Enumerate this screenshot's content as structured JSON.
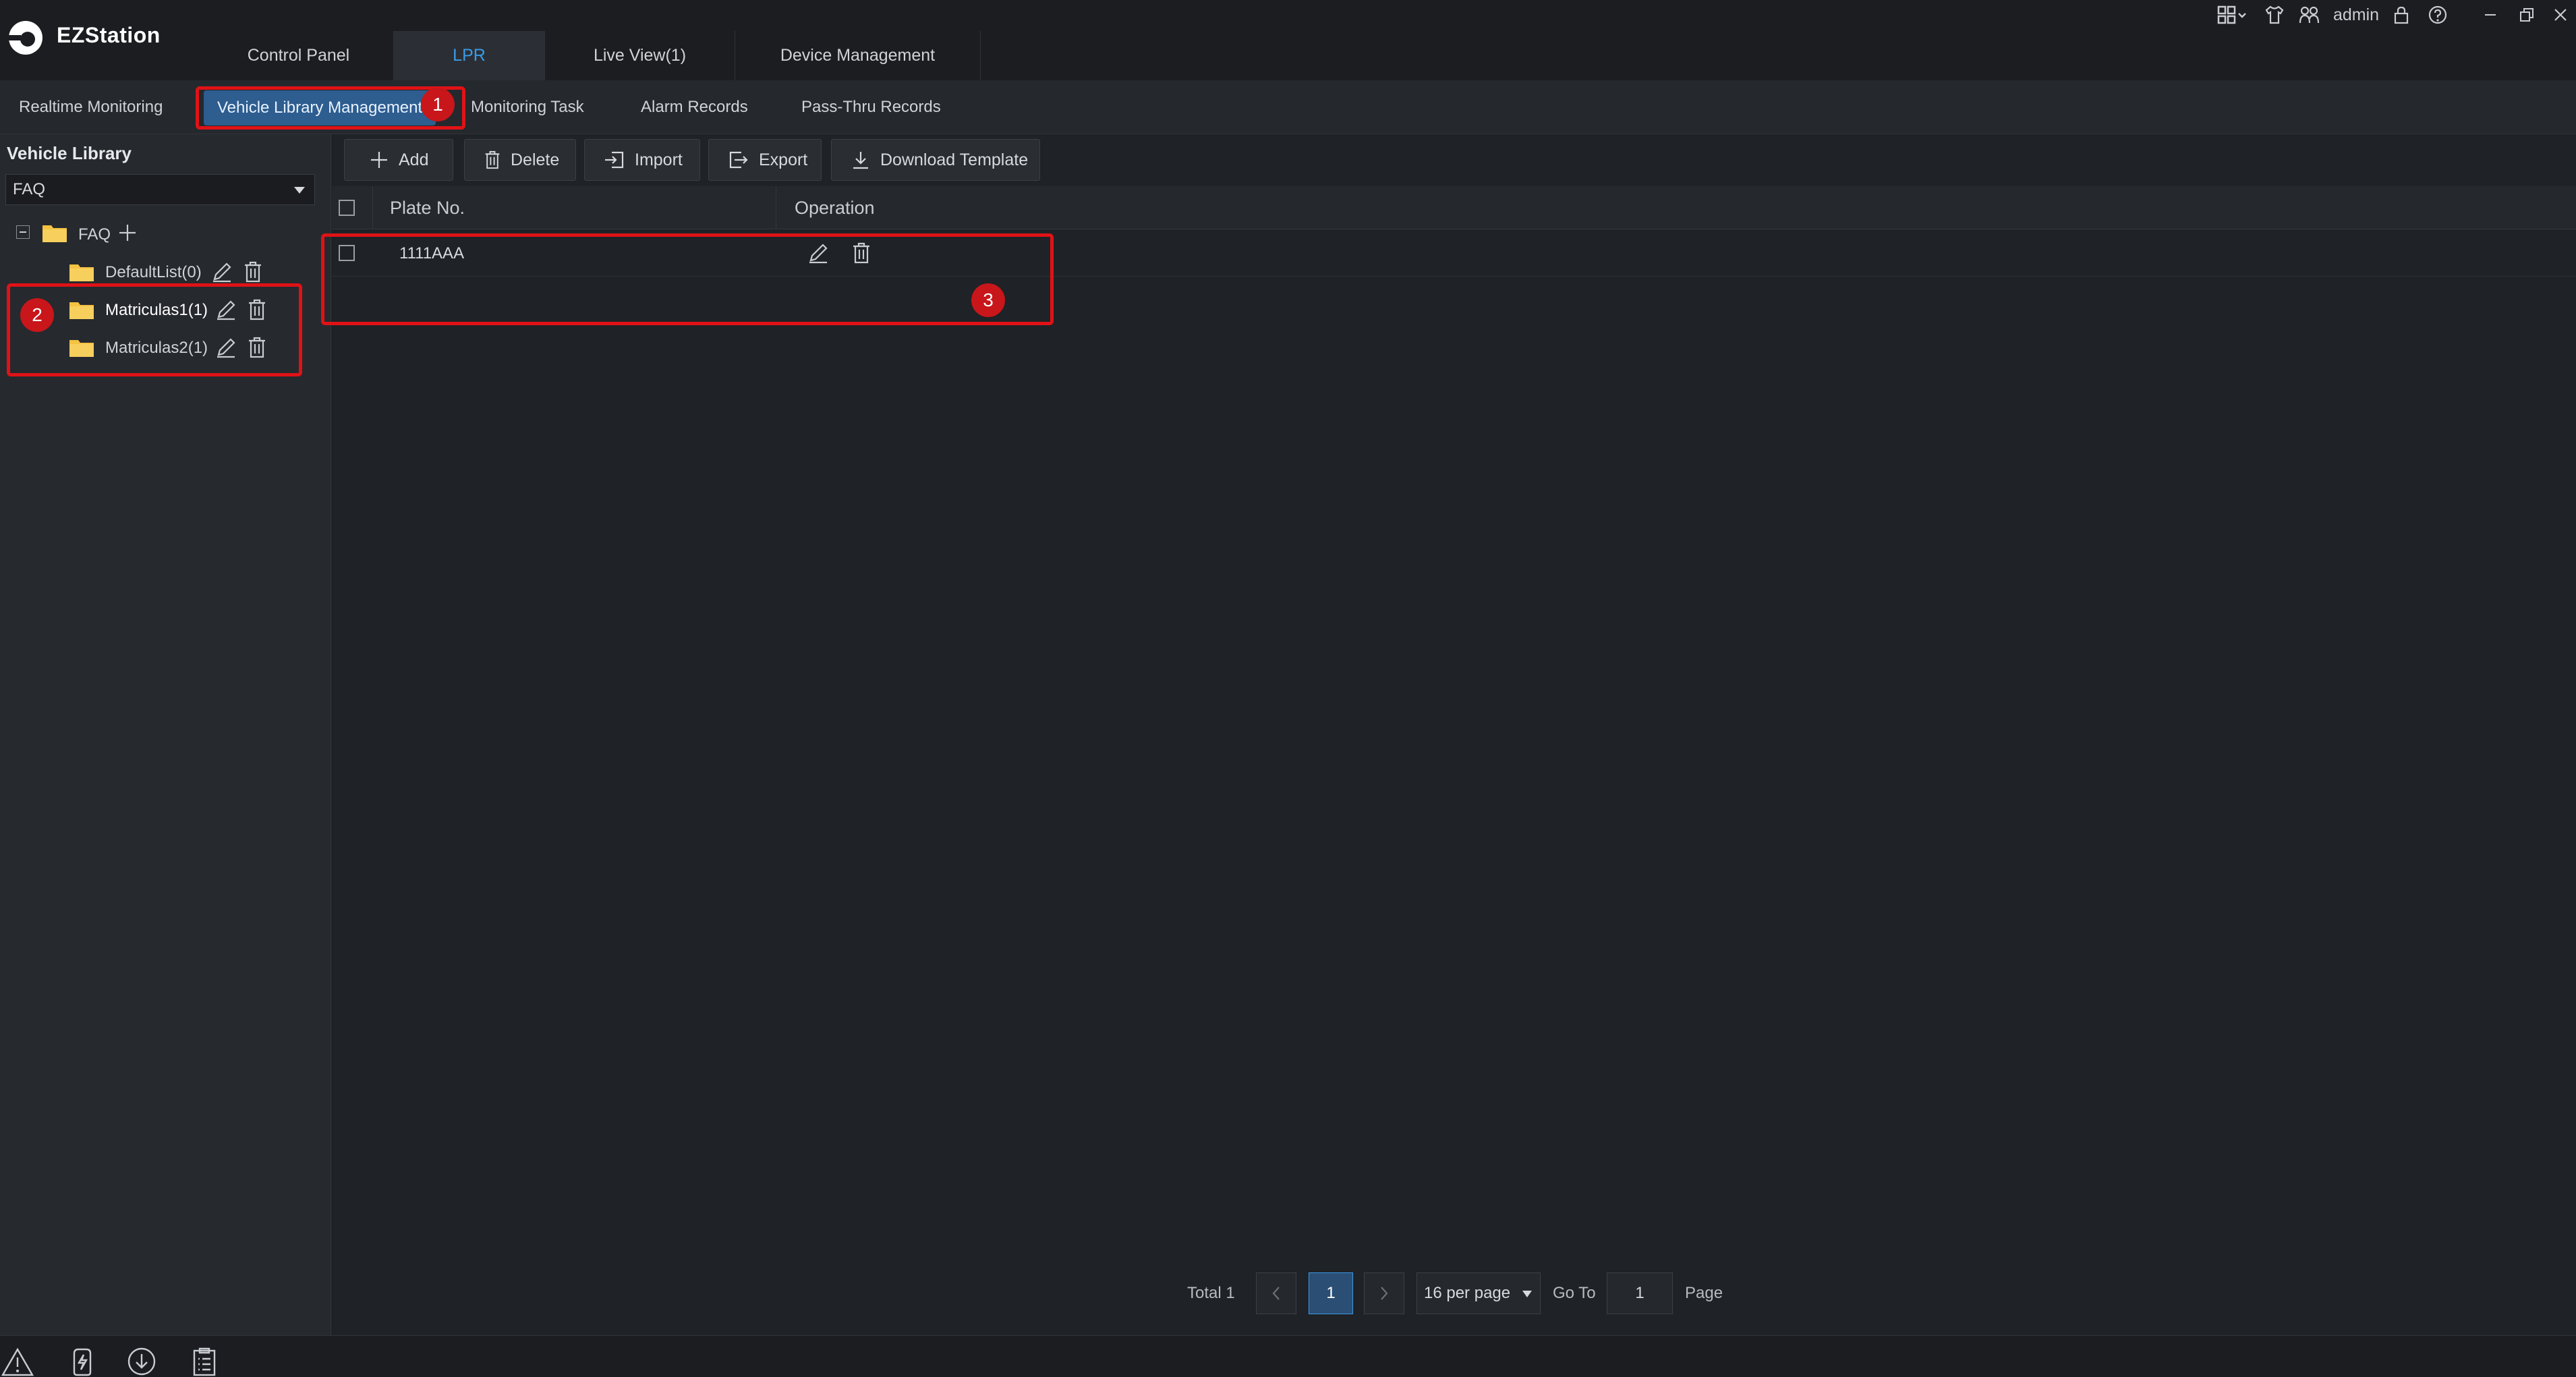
{
  "app": {
    "title": "EZStation"
  },
  "main_tabs": [
    {
      "label": "Control Panel"
    },
    {
      "label": "LPR"
    },
    {
      "label": "Live View(1)"
    },
    {
      "label": "Device Management"
    }
  ],
  "window_controls": {
    "user": "admin"
  },
  "sub_tabs": [
    {
      "label": "Realtime Monitoring"
    },
    {
      "label": "Vehicle Library Management"
    },
    {
      "label": "Monitoring Task"
    },
    {
      "label": "Alarm Records"
    },
    {
      "label": "Pass-Thru Records"
    }
  ],
  "annotations": [
    "1",
    "2",
    "3"
  ],
  "sidebar": {
    "heading": "Vehicle Library",
    "select_value": "FAQ",
    "tree_root": "FAQ",
    "lists": [
      {
        "label": "DefaultList(0)"
      },
      {
        "label": "Matriculas1(1)"
      },
      {
        "label": "Matriculas2(1)"
      }
    ]
  },
  "toolbar": {
    "add": "Add",
    "delete": "Delete",
    "import": "Import",
    "export": "Export",
    "download_template": "Download Template"
  },
  "table": {
    "columns": [
      "Plate No.",
      "Operation"
    ],
    "rows": [
      {
        "plate": "1111AAA"
      }
    ]
  },
  "pagination": {
    "total": "Total 1",
    "current_page": "1",
    "per_page": "16 per page",
    "goto_label": "Go To",
    "goto_value": "1",
    "page_label": "Page"
  },
  "colors": {
    "accent": "#3b9be8",
    "annotation": "#e01216",
    "folder": "#f5c242"
  }
}
